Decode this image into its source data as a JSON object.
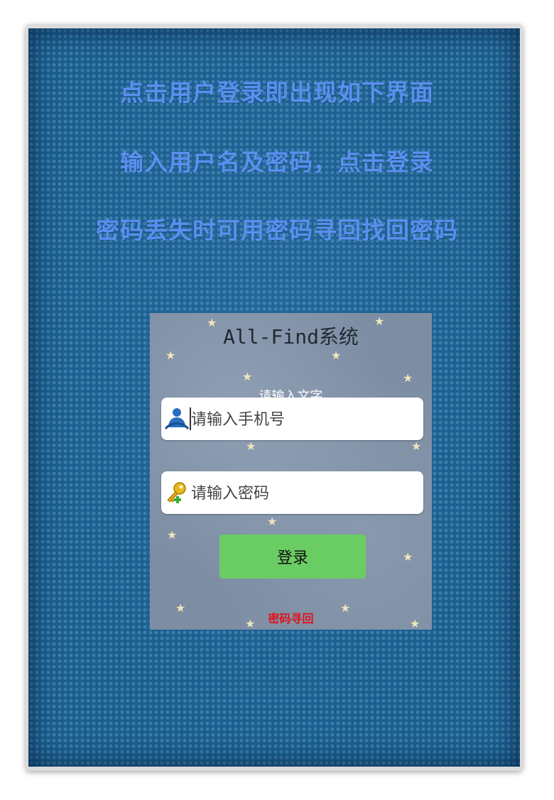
{
  "instructions": [
    "点击用户登录即出现如下界面",
    "输入用户名及密码，点击登录",
    "密码丢失时可用密码寻回找回密码"
  ],
  "app": {
    "title": "All-Find系统",
    "hint_text": "请输入文字",
    "phone_placeholder": "请输入手机号",
    "password_placeholder": "请输入密码",
    "login_label": "登录",
    "recover_label": "密码寻回",
    "icons": {
      "phone_field": "user-icon",
      "password_field": "key-icon"
    }
  },
  "colors": {
    "instruction_text": "#5b8ff0",
    "login_button": "#6acd63",
    "recover_link": "#e0121a",
    "panel_background": "#1a5e8e"
  }
}
